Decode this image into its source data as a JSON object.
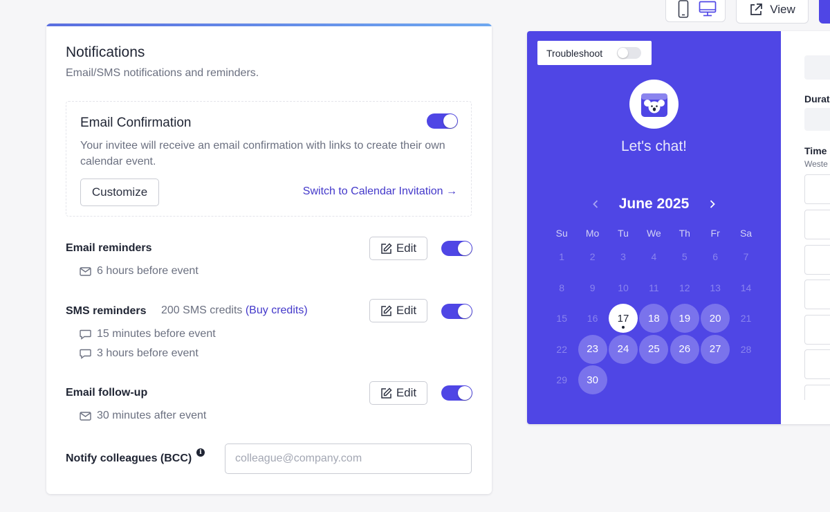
{
  "toolbar": {
    "mobile_icon": "mobile-phone-icon",
    "desktop_icon": "desktop-monitor-icon",
    "view_label": "View",
    "accent_color": "#4f46e5"
  },
  "notifications": {
    "title": "Notifications",
    "subtitle": "Email/SMS notifications and reminders.",
    "email_confirmation": {
      "title": "Email Confirmation",
      "description": "Your invitee will receive an email confirmation with links to create their own calendar event.",
      "customize_label": "Customize",
      "switch_link": "Switch to Calendar Invitation →",
      "enabled": true
    },
    "email_reminders": {
      "label": "Email reminders",
      "edit_label": "Edit",
      "enabled": true,
      "items": [
        "6 hours before event"
      ]
    },
    "sms_reminders": {
      "label": "SMS reminders",
      "credits": "200 SMS credits",
      "buy_credits": "(Buy credits)",
      "edit_label": "Edit",
      "enabled": true,
      "items": [
        "15 minutes before event",
        "3 hours before event"
      ]
    },
    "email_followup": {
      "label": "Email follow-up",
      "edit_label": "Edit",
      "enabled": true,
      "items": [
        "30 minutes after event"
      ]
    },
    "bcc": {
      "label": "Notify colleagues (BCC)",
      "info": "i",
      "placeholder": "colleague@company.com",
      "value": ""
    }
  },
  "preview": {
    "troubleshoot_label": "Troubleshoot",
    "troubleshoot_enabled": false,
    "title": "Let's chat!",
    "month": "June 2025",
    "weekdays": [
      "Su",
      "Mo",
      "Tu",
      "We",
      "Th",
      "Fr",
      "Sa"
    ],
    "weeks": [
      [
        "1",
        "2",
        "3",
        "4",
        "5",
        "6",
        "7"
      ],
      [
        "8",
        "9",
        "10",
        "11",
        "12",
        "13",
        "14"
      ],
      [
        "15",
        "16",
        "17",
        "18",
        "19",
        "20",
        "21"
      ],
      [
        "22",
        "23",
        "24",
        "25",
        "26",
        "27",
        "28"
      ],
      [
        "29",
        "30",
        "",
        "",
        "",
        "",
        ""
      ]
    ],
    "today": "17",
    "available_days": [
      "18",
      "19",
      "20",
      "23",
      "24",
      "25",
      "26",
      "27",
      "30"
    ],
    "panel_color": "#4f46e5",
    "right_panel": {
      "duration_label": "Durat",
      "time_label": "Time",
      "timezone": "Weste"
    }
  }
}
